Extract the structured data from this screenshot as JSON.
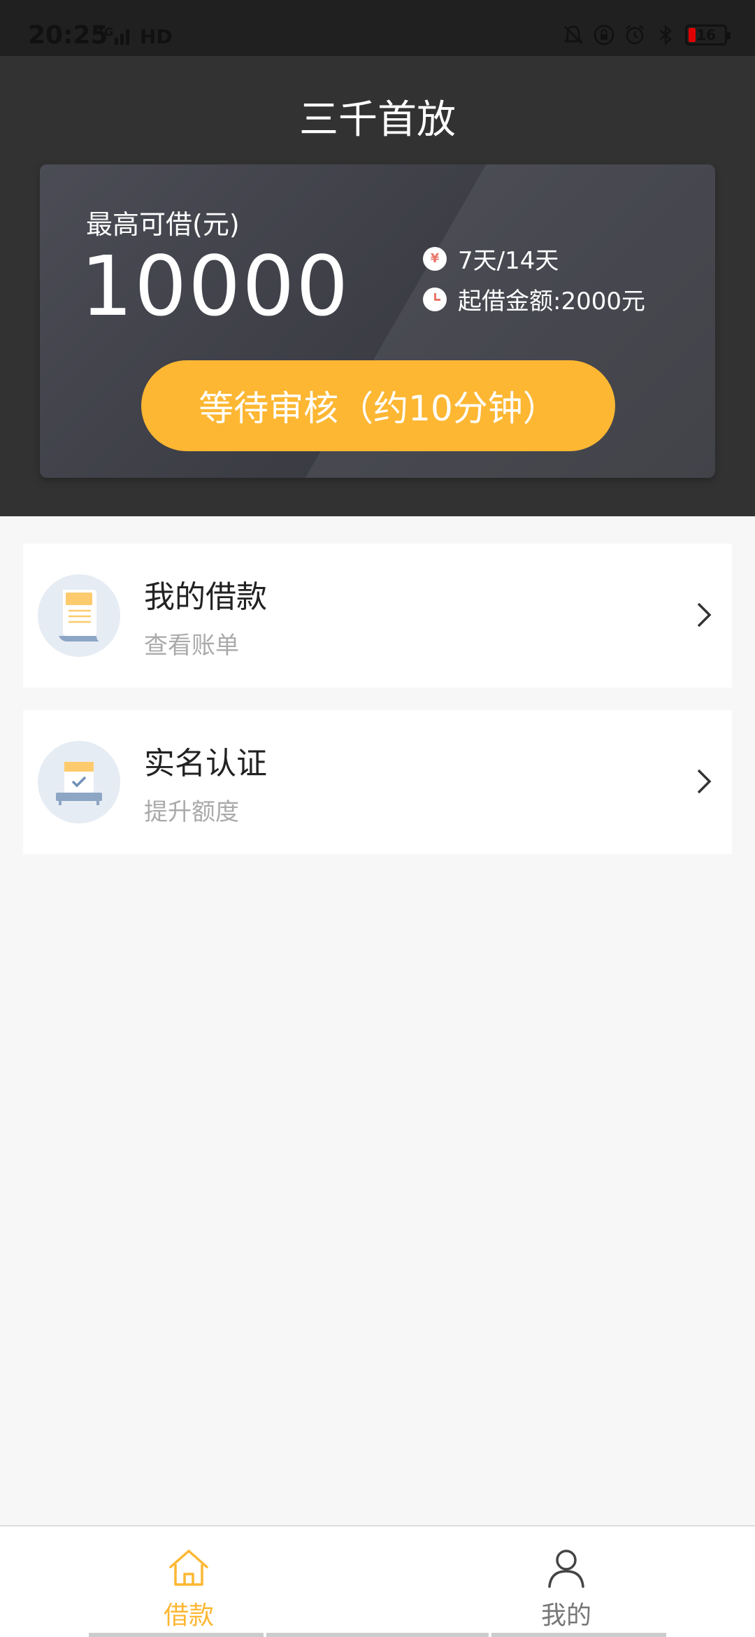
{
  "status_bar": {
    "time": "20:25",
    "network": "4G",
    "hd": "HD",
    "battery": "16"
  },
  "header": {
    "title": "三千首放"
  },
  "loan_card": {
    "label": "最高可借(元)",
    "amount": "10000",
    "term_icon_glyph": "¥",
    "term": "7天/14天",
    "min_amount": "起借金额:2000元",
    "button_label": "等待审核（约10分钟）",
    "button_color": "#fdb733"
  },
  "menu": [
    {
      "title": "我的借款",
      "subtitle": "查看账单",
      "icon": "bill-document-icon"
    },
    {
      "title": "实名认证",
      "subtitle": "提升额度",
      "icon": "id-verification-icon"
    }
  ],
  "bottom_nav": {
    "items": [
      {
        "label": "借款",
        "icon": "home-icon",
        "active": true
      },
      {
        "label": "我的",
        "icon": "person-icon",
        "active": false
      }
    ],
    "active_color": "#fdb733"
  }
}
